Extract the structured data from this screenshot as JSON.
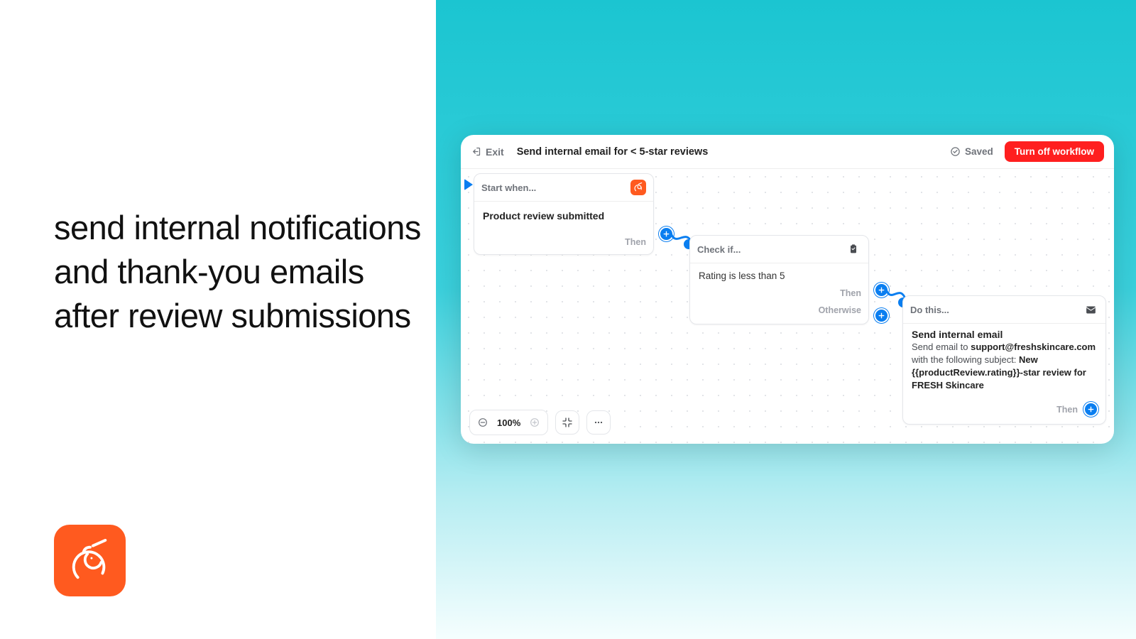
{
  "headline": "send internal notifications and thank-you emails after review submissions",
  "brand_name": "unicorn-logo",
  "topbar": {
    "exit": "Exit",
    "title": "Send internal email for < 5-star reviews",
    "saved": "Saved",
    "turn_off": "Turn off workflow"
  },
  "trigger": {
    "header": "Start when...",
    "body": "Product review submitted",
    "then": "Then"
  },
  "check": {
    "header": "Check if...",
    "body": "Rating is less than 5",
    "then": "Then",
    "otherwise": "Otherwise"
  },
  "do": {
    "header": "Do this...",
    "title": "Send internal email",
    "body_pre": "Send email to ",
    "email": "support@freshskincare.com",
    "body_mid": " with the following subject: ",
    "subject": "New {{productReview.rating}}-star review for FRESH Skincare",
    "then": "Then"
  },
  "zoom": {
    "value": "100%"
  }
}
